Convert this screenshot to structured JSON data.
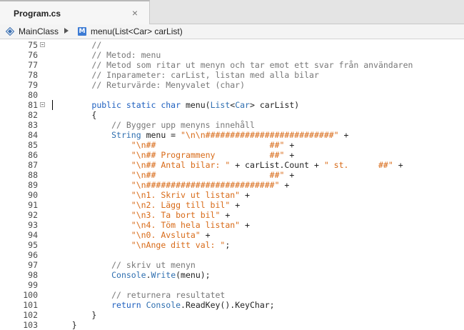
{
  "tab": {
    "title": "Program.cs",
    "close_glyph": "×"
  },
  "breadcrumb": {
    "class_icon": "class-diamond-icon",
    "class_name": "MainClass",
    "separator_icon": "chevron-right-icon",
    "method_icon": "method-icon",
    "method_icon_letter": "M",
    "method_signature": "menu(List<Car> carList)"
  },
  "colors": {
    "comment": "#777777",
    "keyword": "#1d5fbf",
    "type": "#2f6fb0",
    "string": "#d86a17",
    "plain": "#222222"
  },
  "code_lines": [
    {
      "n": "75",
      "fold": true,
      "segs": [
        {
          "t": "        "
        },
        {
          "t": "//",
          "c": "cm"
        }
      ]
    },
    {
      "n": "76",
      "fold": false,
      "segs": [
        {
          "t": "        "
        },
        {
          "t": "// Metod: menu",
          "c": "cm"
        }
      ]
    },
    {
      "n": "77",
      "fold": false,
      "segs": [
        {
          "t": "        "
        },
        {
          "t": "// Metod som ritar ut menyn och tar emot ett svar från användaren",
          "c": "cm"
        }
      ]
    },
    {
      "n": "78",
      "fold": false,
      "segs": [
        {
          "t": "        "
        },
        {
          "t": "// Inparameter: carList, listan med alla bilar",
          "c": "cm"
        }
      ]
    },
    {
      "n": "79",
      "fold": false,
      "segs": [
        {
          "t": "        "
        },
        {
          "t": "// Returvärde: Menyvalet (char)",
          "c": "cm"
        }
      ]
    },
    {
      "n": "80",
      "fold": false,
      "segs": []
    },
    {
      "n": "81",
      "fold": true,
      "segs": [
        {
          "t": "        "
        },
        {
          "t": "public static char",
          "c": "kw"
        },
        {
          "t": " menu("
        },
        {
          "t": "List",
          "c": "ty"
        },
        {
          "t": "<"
        },
        {
          "t": "Car",
          "c": "ty"
        },
        {
          "t": "> carList)"
        }
      ]
    },
    {
      "n": "82",
      "fold": false,
      "segs": [
        {
          "t": "        {"
        }
      ]
    },
    {
      "n": "83",
      "fold": false,
      "segs": [
        {
          "t": "            "
        },
        {
          "t": "// Bygger upp menyns innehåll",
          "c": "cm"
        }
      ]
    },
    {
      "n": "84",
      "fold": false,
      "segs": [
        {
          "t": "            "
        },
        {
          "t": "String",
          "c": "ty"
        },
        {
          "t": " menu = "
        },
        {
          "t": "\"\\n\\n##########################\"",
          "c": "st"
        },
        {
          "t": " +"
        }
      ]
    },
    {
      "n": "85",
      "fold": false,
      "segs": [
        {
          "t": "                "
        },
        {
          "t": "\"\\n##                       ##\"",
          "c": "st"
        },
        {
          "t": " +"
        }
      ]
    },
    {
      "n": "86",
      "fold": false,
      "segs": [
        {
          "t": "                "
        },
        {
          "t": "\"\\n## Programmeny           ##\"",
          "c": "st"
        },
        {
          "t": " +"
        }
      ]
    },
    {
      "n": "87",
      "fold": false,
      "segs": [
        {
          "t": "                "
        },
        {
          "t": "\"\\n## Antal bilar: \"",
          "c": "st"
        },
        {
          "t": " + carList.Count + "
        },
        {
          "t": "\" st.      ##\"",
          "c": "st"
        },
        {
          "t": " +"
        }
      ]
    },
    {
      "n": "88",
      "fold": false,
      "segs": [
        {
          "t": "                "
        },
        {
          "t": "\"\\n##                       ##\"",
          "c": "st"
        },
        {
          "t": " +"
        }
      ]
    },
    {
      "n": "89",
      "fold": false,
      "segs": [
        {
          "t": "                "
        },
        {
          "t": "\"\\n##########################\"",
          "c": "st"
        },
        {
          "t": " +"
        }
      ]
    },
    {
      "n": "90",
      "fold": false,
      "segs": [
        {
          "t": "                "
        },
        {
          "t": "\"\\n1. Skriv ut listan\"",
          "c": "st"
        },
        {
          "t": " +"
        }
      ]
    },
    {
      "n": "91",
      "fold": false,
      "segs": [
        {
          "t": "                "
        },
        {
          "t": "\"\\n2. Lägg till bil\"",
          "c": "st"
        },
        {
          "t": " +"
        }
      ]
    },
    {
      "n": "92",
      "fold": false,
      "segs": [
        {
          "t": "                "
        },
        {
          "t": "\"\\n3. Ta bort bil\"",
          "c": "st"
        },
        {
          "t": " +"
        }
      ]
    },
    {
      "n": "93",
      "fold": false,
      "segs": [
        {
          "t": "                "
        },
        {
          "t": "\"\\n4. Töm hela listan\"",
          "c": "st"
        },
        {
          "t": " +"
        }
      ]
    },
    {
      "n": "94",
      "fold": false,
      "segs": [
        {
          "t": "                "
        },
        {
          "t": "\"\\n0. Avsluta\"",
          "c": "st"
        },
        {
          "t": " +"
        }
      ]
    },
    {
      "n": "95",
      "fold": false,
      "segs": [
        {
          "t": "                "
        },
        {
          "t": "\"\\nAnge ditt val: \"",
          "c": "st"
        },
        {
          "t": ";"
        }
      ]
    },
    {
      "n": "96",
      "fold": false,
      "segs": []
    },
    {
      "n": "97",
      "fold": false,
      "segs": [
        {
          "t": "            "
        },
        {
          "t": "// skriv ut menyn",
          "c": "cm"
        }
      ]
    },
    {
      "n": "98",
      "fold": false,
      "segs": [
        {
          "t": "            "
        },
        {
          "t": "Console",
          "c": "ty"
        },
        {
          "t": "."
        },
        {
          "t": "Write",
          "c": "ty"
        },
        {
          "t": "(menu);"
        }
      ]
    },
    {
      "n": "99",
      "fold": false,
      "segs": []
    },
    {
      "n": "100",
      "fold": false,
      "segs": [
        {
          "t": "            "
        },
        {
          "t": "// returnera resultatet",
          "c": "cm"
        }
      ]
    },
    {
      "n": "101",
      "fold": false,
      "segs": [
        {
          "t": "            "
        },
        {
          "t": "return",
          "c": "kw"
        },
        {
          "t": " "
        },
        {
          "t": "Console",
          "c": "ty"
        },
        {
          "t": ".ReadKey().KeyChar;"
        }
      ]
    },
    {
      "n": "102",
      "fold": false,
      "segs": [
        {
          "t": "        }"
        }
      ]
    },
    {
      "n": "103",
      "fold": false,
      "segs": [
        {
          "t": "    }"
        }
      ]
    }
  ],
  "cursor": {
    "line": "81",
    "column": 30
  }
}
